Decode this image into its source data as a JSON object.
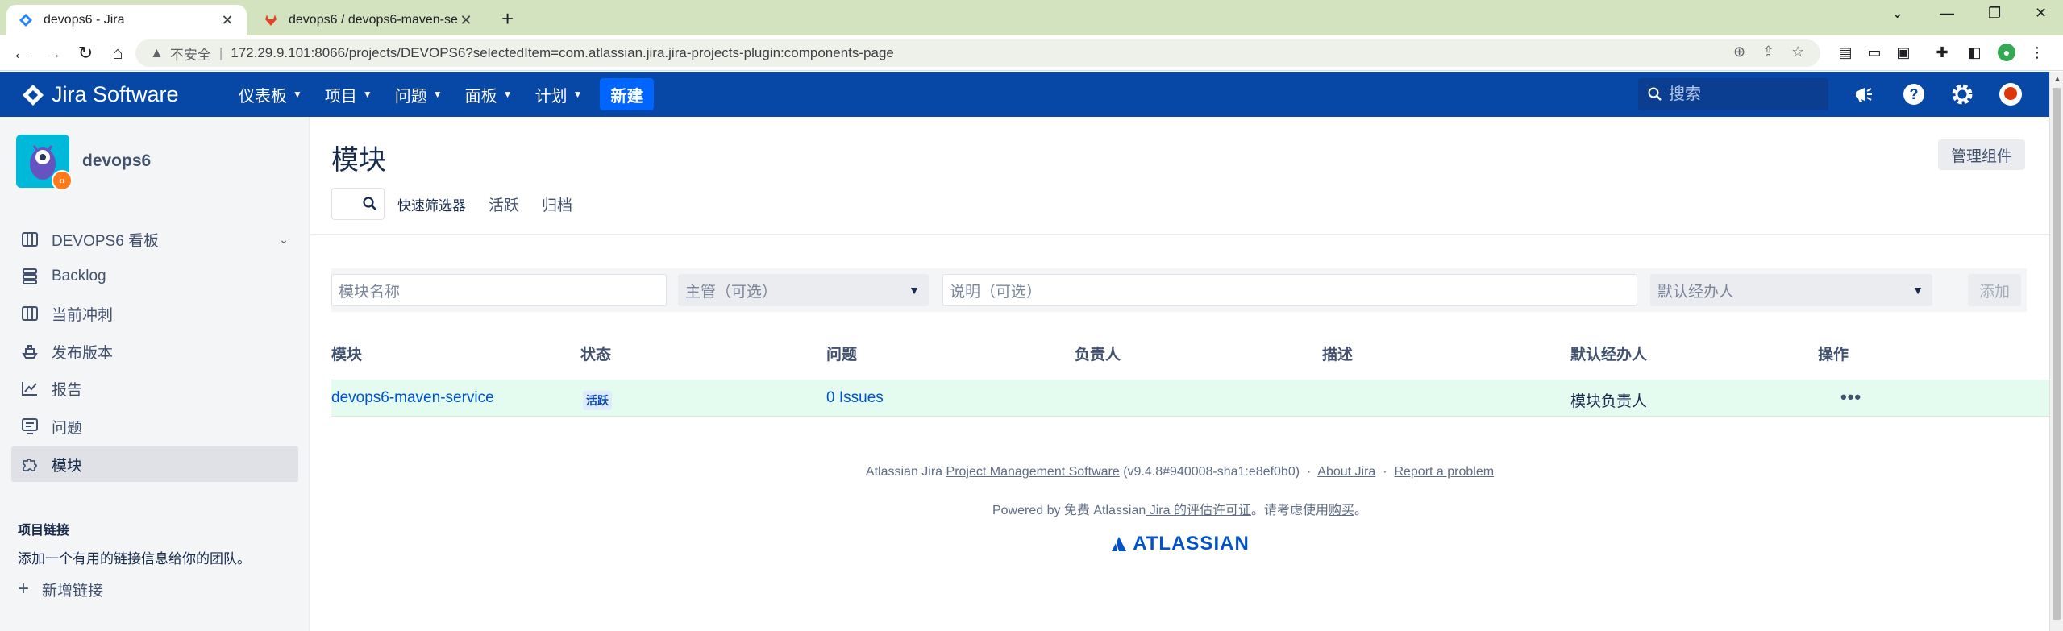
{
  "browser": {
    "tabs": [
      {
        "title": "devops6 - Jira",
        "active": true
      },
      {
        "title": "devops6 / devops6-maven-ser",
        "active": false
      }
    ],
    "insecure_label": "不安全",
    "url": "172.29.9.101:8066/projects/DEVOPS6?selectedItem=com.atlassian.jira.jira-projects-plugin:components-page"
  },
  "header": {
    "logo_text": "Jira Software",
    "nav": [
      "仪表板",
      "项目",
      "问题",
      "面板",
      "计划"
    ],
    "create_label": "新建",
    "search_placeholder": "搜索"
  },
  "sidebar": {
    "project_name": "devops6",
    "board_label": "DEVOPS6 看板",
    "items": [
      "Backlog",
      "当前冲刺",
      "发布版本",
      "报告",
      "问题",
      "模块"
    ],
    "links_heading": "项目链接",
    "links_desc": "添加一个有用的链接信息给你的团队。",
    "add_link_label": "新增链接"
  },
  "main": {
    "title": "模块",
    "manage_label": "管理组件",
    "quick_filters_label": "快速筛选器",
    "filter_tabs": [
      "活跃",
      "归档"
    ],
    "form": {
      "name_placeholder": "模块名称",
      "lead_placeholder": "主管（可选）",
      "desc_placeholder": "说明（可选）",
      "assignee_placeholder": "默认经办人",
      "add_label": "添加"
    },
    "columns": [
      "模块",
      "状态",
      "问题",
      "负责人",
      "描述",
      "默认经办人",
      "操作"
    ],
    "rows": [
      {
        "name": "devops6-maven-service",
        "status": "活跃",
        "issues": "0 Issues",
        "lead": "",
        "description": "",
        "assignee": "模块负责人",
        "actions": "•••"
      }
    ]
  },
  "footer": {
    "line1_prefix": "Atlassian Jira",
    "line1_link": "Project Management Software",
    "line1_version": "(v9.4.8#940008-sha1:e8ef0b0)",
    "about": "About Jira",
    "report": "Report a problem",
    "line2_prefix": "Powered by 免费 Atlassian",
    "line2_link1": " Jira 的评估许可证",
    "line2_mid": "。请考虑使用",
    "line2_link2": "购买",
    "line2_end": "。",
    "brand": "ATLASSIAN"
  },
  "colors": {
    "header_bg": "#0747a6",
    "create_btn": "#0065ff",
    "row_highlight": "#e3fcef",
    "link": "#0052cc"
  }
}
